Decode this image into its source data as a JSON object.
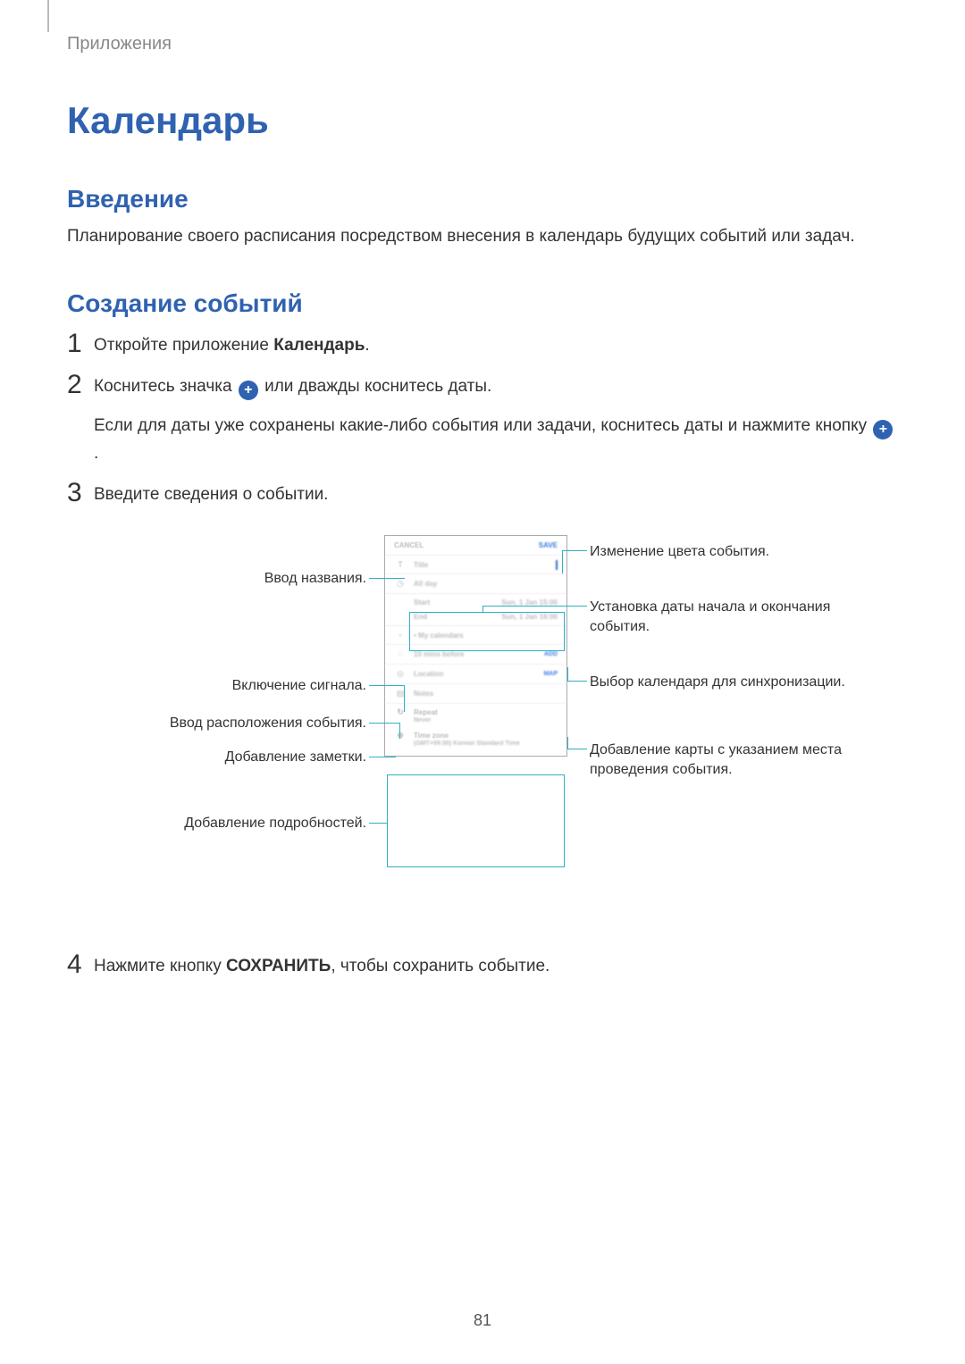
{
  "breadcrumb": "Приложения",
  "page_title": "Календарь",
  "section_intro": {
    "title": "Введение",
    "text": "Планирование своего расписания посредством внесения в календарь будущих событий или задач."
  },
  "section_create": {
    "title": "Создание событий",
    "steps": {
      "1": {
        "num": "1",
        "text_before": "Откройте приложение ",
        "bold": "Календарь",
        "text_after": "."
      },
      "2": {
        "num": "2",
        "line1_before": "Коснитесь значка ",
        "line1_after": " или дважды коснитесь даты.",
        "line2_before": "Если для даты уже сохранены какие-либо события или задачи, коснитесь даты и нажмите кнопку ",
        "line2_after": "."
      },
      "3": {
        "num": "3",
        "text": "Введите сведения о событии."
      },
      "4": {
        "num": "4",
        "text_before": "Нажмите кнопку ",
        "bold": "СОХРАНИТЬ",
        "text_after": ", чтобы сохранить событие."
      }
    }
  },
  "diagram_labels": {
    "left": {
      "title": "Ввод названия.",
      "alarm": "Включение сигнала.",
      "location": "Ввод расположения события.",
      "notes": "Добавление заметки.",
      "details": "Добавление подробностей."
    },
    "right": {
      "color": "Изменение цвета события.",
      "dates": "Установка даты начала и окончания события.",
      "calendar": "Выбор календаря для синхронизации.",
      "map": "Добавление карты с указанием места проведения события."
    }
  },
  "phone": {
    "cancel": "CANCEL",
    "save": "SAVE",
    "title_placeholder": "Title",
    "allday": "All day",
    "start_label": "Start",
    "start_value": "Sun, 1 Jan  15:00",
    "end_label": "End",
    "end_value": "Sun, 1 Jan  16:00",
    "my_calendars": "• My calendars",
    "reminder": "10 mins before",
    "reminder_add": "ADD",
    "location": "Location",
    "map": "MAP",
    "notes": "Notes",
    "repeat": "Repeat",
    "repeat_val": "Never",
    "timezone": "Time zone",
    "timezone_val": "(GMT+09:00) Korean Standard Time"
  },
  "page_number": "81",
  "icons": {
    "plus": "+"
  }
}
